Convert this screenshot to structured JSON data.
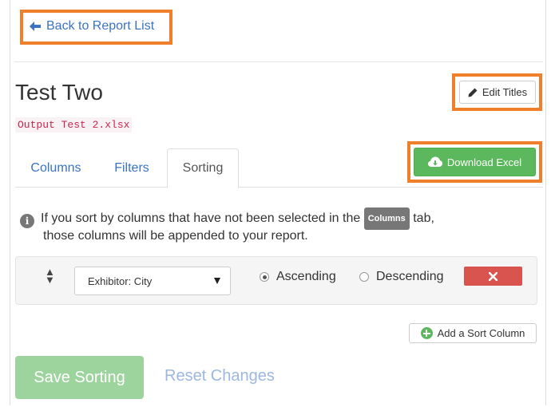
{
  "nav": {
    "back_label": "Back to Report List"
  },
  "report": {
    "title": "Test Two",
    "file_name": "Output Test 2.xlsx",
    "edit_titles_label": "Edit Titles",
    "download_label": "Download Excel"
  },
  "tabs": [
    {
      "label": "Columns",
      "active": false
    },
    {
      "label": "Filters",
      "active": false
    },
    {
      "label": "Sorting",
      "active": true
    }
  ],
  "info": {
    "text_before": "If you sort by columns that have not been selected in the",
    "badge": "Columns",
    "text_after": "tab,",
    "line2": "those columns will be appended to your report."
  },
  "sort_rows": [
    {
      "column": "Exhibitor: City",
      "ascending_label": "Ascending",
      "descending_label": "Descending",
      "direction": "ascending"
    }
  ],
  "add_sort_label": "Add a Sort Column",
  "actions": {
    "save_label": "Save Sorting",
    "reset_label": "Reset Changes"
  },
  "colors": {
    "highlight": "#f07f2c",
    "link": "#3a73c4",
    "success": "#5cb85c",
    "danger": "#d9534f",
    "code": "#c7254e"
  },
  "icons": [
    "arrow-left-icon",
    "pencil-icon",
    "cloud-download-icon",
    "info-circle-icon",
    "sort-handle-icon",
    "remove-icon",
    "plus-circle-icon"
  ]
}
